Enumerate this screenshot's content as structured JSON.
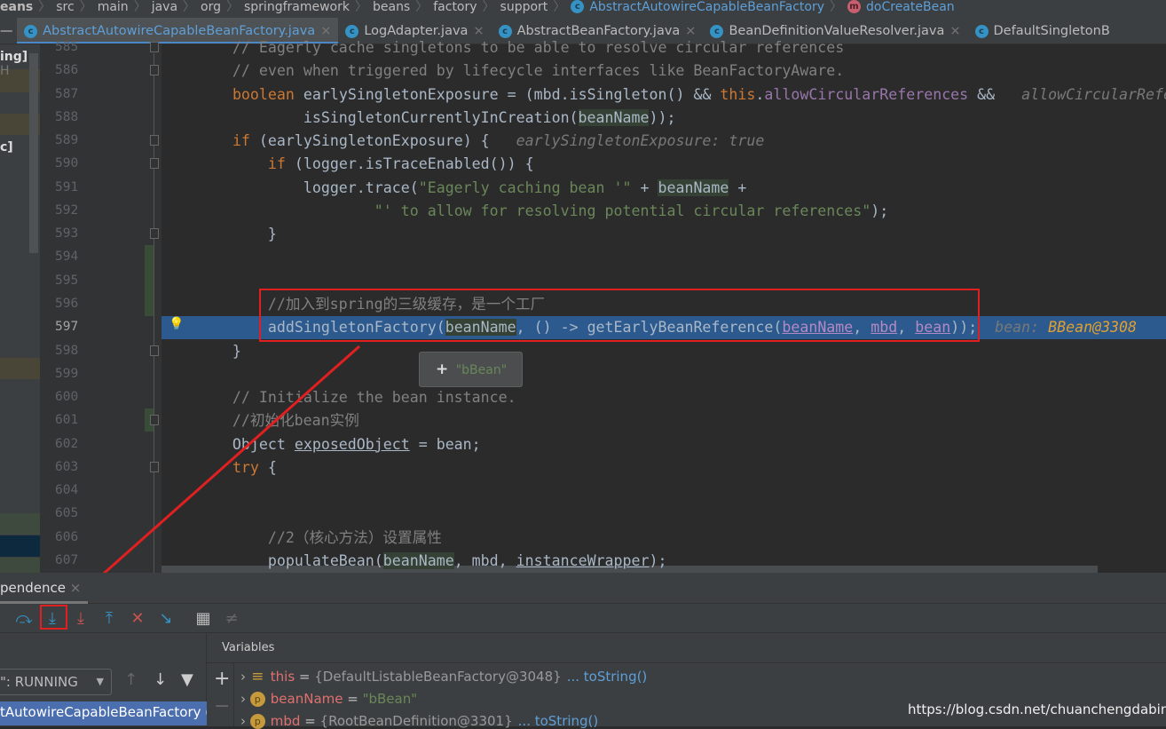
{
  "breadcrumb": [
    "eans",
    "src",
    "main",
    "java",
    "org",
    "springframework",
    "beans",
    "factory",
    "support",
    "AbstractAutowireCapableBeanFactory",
    "doCreateBean"
  ],
  "tabs": [
    {
      "label": "AbstractAutowireCapableBeanFactory.java",
      "active": true
    },
    {
      "label": "LogAdapter.java"
    },
    {
      "label": "AbstractBeanFactory.java"
    },
    {
      "label": "BeanDefinitionValueResolver.java"
    },
    {
      "label": "DefaultSingletonB"
    }
  ],
  "left_panel": {
    "item1": "ing]",
    "item1_suffix": "H",
    "item2": "c]"
  },
  "editor": {
    "current_line": 597,
    "lines": [
      {
        "n": 585,
        "s": [
          [
            "        // Eagerly cache singletons to be able to resolve circular references",
            "cm"
          ]
        ]
      },
      {
        "n": 586,
        "s": [
          [
            "        // even when triggered by lifecycle interfaces like BeanFactoryAware.",
            "cm"
          ]
        ]
      },
      {
        "n": 587,
        "s": [
          [
            "        ",
            ""
          ],
          [
            "boolean ",
            "kw"
          ],
          [
            "earlySingletonExposure = (mbd.isSingleton() && ",
            ""
          ],
          [
            "this",
            "kw"
          ],
          [
            ".",
            ""
          ],
          [
            "allowCircularReferences",
            "fld"
          ],
          [
            " &&   ",
            ""
          ],
          [
            "allowCircularRefe",
            "hint"
          ]
        ]
      },
      {
        "n": 588,
        "s": [
          [
            "                isSingletonCurrentlyInCreation(",
            ""
          ],
          [
            "beanName",
            "hl"
          ],
          [
            "));",
            ""
          ]
        ]
      },
      {
        "n": 589,
        "s": [
          [
            "        ",
            ""
          ],
          [
            "if ",
            "kw"
          ],
          [
            "(earlySingletonExposure) {   ",
            ""
          ],
          [
            "earlySingletonExposure: true",
            "hint"
          ]
        ]
      },
      {
        "n": 590,
        "s": [
          [
            "            ",
            ""
          ],
          [
            "if ",
            "kw"
          ],
          [
            "(logger.isTraceEnabled()) {",
            ""
          ]
        ]
      },
      {
        "n": 591,
        "s": [
          [
            "                logger.trace(",
            ""
          ],
          [
            "\"Eagerly caching bean '\"",
            "str"
          ],
          [
            " + ",
            ""
          ],
          [
            "beanName",
            "hl"
          ],
          [
            " +",
            ""
          ]
        ]
      },
      {
        "n": 592,
        "s": [
          [
            "                        ",
            ""
          ],
          [
            "\"' to allow for resolving potential circular references\"",
            "str"
          ],
          [
            ");",
            ""
          ]
        ]
      },
      {
        "n": 593,
        "s": [
          [
            "            }",
            ""
          ]
        ]
      },
      {
        "n": 594,
        "s": []
      },
      {
        "n": 595,
        "s": []
      },
      {
        "n": 596,
        "s": [
          [
            "            //加入到spring的三级缓存，是一个工厂",
            "cm"
          ]
        ]
      },
      {
        "n": 597,
        "s": [
          [
            "            addSingletonFactory(",
            ""
          ],
          [
            "beanName",
            "hl"
          ],
          [
            ", () -> getEarlyBeanReference(",
            ""
          ],
          [
            "beanName",
            "ul"
          ],
          [
            ", ",
            ""
          ],
          [
            "mbd",
            "ul"
          ],
          [
            ", ",
            ""
          ],
          [
            "bean",
            "ul"
          ],
          [
            "));  ",
            ""
          ],
          [
            "bean: ",
            "hint"
          ],
          [
            "BBean@3308",
            "hintv"
          ]
        ]
      },
      {
        "n": 598,
        "s": [
          [
            "        }",
            ""
          ]
        ]
      },
      {
        "n": 599,
        "s": []
      },
      {
        "n": 600,
        "s": [
          [
            "        // Initialize the bean instance.",
            "cm"
          ]
        ]
      },
      {
        "n": 601,
        "s": [
          [
            "        //初始化bean实例",
            "cm"
          ]
        ]
      },
      {
        "n": 602,
        "s": [
          [
            "        Object ",
            ""
          ],
          [
            "exposedObject",
            "ulp"
          ],
          [
            " = bean;",
            ""
          ]
        ]
      },
      {
        "n": 603,
        "s": [
          [
            "        ",
            ""
          ],
          [
            "try ",
            "kw"
          ],
          [
            "{",
            ""
          ]
        ]
      },
      {
        "n": 604,
        "s": []
      },
      {
        "n": 605,
        "s": []
      },
      {
        "n": 606,
        "s": [
          [
            "            //2（核心方法）设置属性",
            "cm"
          ]
        ]
      },
      {
        "n": 607,
        "s": [
          [
            "            populateBean(",
            ""
          ],
          [
            "beanName",
            "hl"
          ],
          [
            ", mbd, ",
            ""
          ],
          [
            "instanceWrapper",
            "ulp"
          ],
          [
            ");",
            ""
          ]
        ]
      }
    ],
    "tooltip": {
      "icon": "plus-icon",
      "value": "\"bBean\""
    }
  },
  "debug": {
    "tab_label": "pendence",
    "toolbar": [
      "step-over",
      "step-into",
      "force-step-into",
      "step-out",
      "drop-frame",
      "run-to-cursor",
      "evaluate-expression",
      "trace-stream"
    ],
    "thread_select": "\": RUNNING",
    "frame": "tAutowireCapableBeanFactory (c",
    "variables_title": "Variables",
    "variables": [
      {
        "icon": "field",
        "name": "this",
        "value": "{DefaultListableBeanFactory@3048}",
        "link": "... toString()"
      },
      {
        "icon": "p",
        "name": "beanName",
        "value": "\"bBean\"",
        "link": ""
      },
      {
        "icon": "p",
        "name": "mbd",
        "value": "{RootBeanDefinition@3301}",
        "link": "... toString()"
      }
    ]
  },
  "watermark": "https://blog.csdn.net/chuanchengdabing",
  "colors": {
    "accent": "#4a88c7",
    "current_line": "#2d5a8e",
    "annotation": "#e02020"
  }
}
